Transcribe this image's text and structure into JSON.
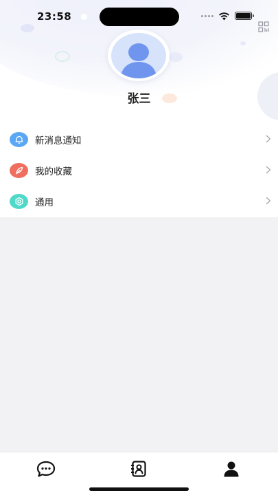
{
  "status_bar": {
    "time": "23:58"
  },
  "profile": {
    "name": "张三"
  },
  "menu": {
    "items": [
      {
        "label": "新消息通知",
        "icon": "bell-icon",
        "color": "#5aa8f5"
      },
      {
        "label": "我的收藏",
        "icon": "feather-icon",
        "color": "#ef6e5f"
      },
      {
        "label": "通用",
        "icon": "settings-icon",
        "color": "#4fd9c9"
      }
    ]
  },
  "tabbar": {
    "tabs": [
      {
        "icon": "chat-bubble-icon",
        "active": false
      },
      {
        "icon": "contacts-book-icon",
        "active": false
      },
      {
        "icon": "person-icon",
        "active": true
      }
    ]
  },
  "colors": {
    "background": "#f2f2f4",
    "avatar_bg": "#d7e2fb",
    "avatar_figure": "#6f95ee"
  }
}
